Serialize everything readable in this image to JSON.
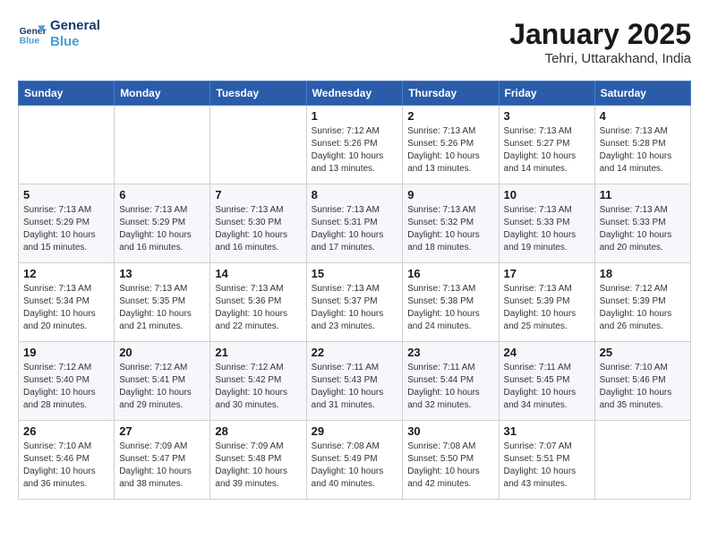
{
  "header": {
    "logo_line1": "General",
    "logo_line2": "Blue",
    "month_year": "January 2025",
    "location": "Tehri, Uttarakhand, India"
  },
  "weekdays": [
    "Sunday",
    "Monday",
    "Tuesday",
    "Wednesday",
    "Thursday",
    "Friday",
    "Saturday"
  ],
  "weeks": [
    [
      {
        "day": "",
        "sunrise": "",
        "sunset": "",
        "daylight": ""
      },
      {
        "day": "",
        "sunrise": "",
        "sunset": "",
        "daylight": ""
      },
      {
        "day": "",
        "sunrise": "",
        "sunset": "",
        "daylight": ""
      },
      {
        "day": "1",
        "sunrise": "Sunrise: 7:12 AM",
        "sunset": "Sunset: 5:26 PM",
        "daylight": "Daylight: 10 hours and 13 minutes."
      },
      {
        "day": "2",
        "sunrise": "Sunrise: 7:13 AM",
        "sunset": "Sunset: 5:26 PM",
        "daylight": "Daylight: 10 hours and 13 minutes."
      },
      {
        "day": "3",
        "sunrise": "Sunrise: 7:13 AM",
        "sunset": "Sunset: 5:27 PM",
        "daylight": "Daylight: 10 hours and 14 minutes."
      },
      {
        "day": "4",
        "sunrise": "Sunrise: 7:13 AM",
        "sunset": "Sunset: 5:28 PM",
        "daylight": "Daylight: 10 hours and 14 minutes."
      }
    ],
    [
      {
        "day": "5",
        "sunrise": "Sunrise: 7:13 AM",
        "sunset": "Sunset: 5:29 PM",
        "daylight": "Daylight: 10 hours and 15 minutes."
      },
      {
        "day": "6",
        "sunrise": "Sunrise: 7:13 AM",
        "sunset": "Sunset: 5:29 PM",
        "daylight": "Daylight: 10 hours and 16 minutes."
      },
      {
        "day": "7",
        "sunrise": "Sunrise: 7:13 AM",
        "sunset": "Sunset: 5:30 PM",
        "daylight": "Daylight: 10 hours and 16 minutes."
      },
      {
        "day": "8",
        "sunrise": "Sunrise: 7:13 AM",
        "sunset": "Sunset: 5:31 PM",
        "daylight": "Daylight: 10 hours and 17 minutes."
      },
      {
        "day": "9",
        "sunrise": "Sunrise: 7:13 AM",
        "sunset": "Sunset: 5:32 PM",
        "daylight": "Daylight: 10 hours and 18 minutes."
      },
      {
        "day": "10",
        "sunrise": "Sunrise: 7:13 AM",
        "sunset": "Sunset: 5:33 PM",
        "daylight": "Daylight: 10 hours and 19 minutes."
      },
      {
        "day": "11",
        "sunrise": "Sunrise: 7:13 AM",
        "sunset": "Sunset: 5:33 PM",
        "daylight": "Daylight: 10 hours and 20 minutes."
      }
    ],
    [
      {
        "day": "12",
        "sunrise": "Sunrise: 7:13 AM",
        "sunset": "Sunset: 5:34 PM",
        "daylight": "Daylight: 10 hours and 20 minutes."
      },
      {
        "day": "13",
        "sunrise": "Sunrise: 7:13 AM",
        "sunset": "Sunset: 5:35 PM",
        "daylight": "Daylight: 10 hours and 21 minutes."
      },
      {
        "day": "14",
        "sunrise": "Sunrise: 7:13 AM",
        "sunset": "Sunset: 5:36 PM",
        "daylight": "Daylight: 10 hours and 22 minutes."
      },
      {
        "day": "15",
        "sunrise": "Sunrise: 7:13 AM",
        "sunset": "Sunset: 5:37 PM",
        "daylight": "Daylight: 10 hours and 23 minutes."
      },
      {
        "day": "16",
        "sunrise": "Sunrise: 7:13 AM",
        "sunset": "Sunset: 5:38 PM",
        "daylight": "Daylight: 10 hours and 24 minutes."
      },
      {
        "day": "17",
        "sunrise": "Sunrise: 7:13 AM",
        "sunset": "Sunset: 5:39 PM",
        "daylight": "Daylight: 10 hours and 25 minutes."
      },
      {
        "day": "18",
        "sunrise": "Sunrise: 7:12 AM",
        "sunset": "Sunset: 5:39 PM",
        "daylight": "Daylight: 10 hours and 26 minutes."
      }
    ],
    [
      {
        "day": "19",
        "sunrise": "Sunrise: 7:12 AM",
        "sunset": "Sunset: 5:40 PM",
        "daylight": "Daylight: 10 hours and 28 minutes."
      },
      {
        "day": "20",
        "sunrise": "Sunrise: 7:12 AM",
        "sunset": "Sunset: 5:41 PM",
        "daylight": "Daylight: 10 hours and 29 minutes."
      },
      {
        "day": "21",
        "sunrise": "Sunrise: 7:12 AM",
        "sunset": "Sunset: 5:42 PM",
        "daylight": "Daylight: 10 hours and 30 minutes."
      },
      {
        "day": "22",
        "sunrise": "Sunrise: 7:11 AM",
        "sunset": "Sunset: 5:43 PM",
        "daylight": "Daylight: 10 hours and 31 minutes."
      },
      {
        "day": "23",
        "sunrise": "Sunrise: 7:11 AM",
        "sunset": "Sunset: 5:44 PM",
        "daylight": "Daylight: 10 hours and 32 minutes."
      },
      {
        "day": "24",
        "sunrise": "Sunrise: 7:11 AM",
        "sunset": "Sunset: 5:45 PM",
        "daylight": "Daylight: 10 hours and 34 minutes."
      },
      {
        "day": "25",
        "sunrise": "Sunrise: 7:10 AM",
        "sunset": "Sunset: 5:46 PM",
        "daylight": "Daylight: 10 hours and 35 minutes."
      }
    ],
    [
      {
        "day": "26",
        "sunrise": "Sunrise: 7:10 AM",
        "sunset": "Sunset: 5:46 PM",
        "daylight": "Daylight: 10 hours and 36 minutes."
      },
      {
        "day": "27",
        "sunrise": "Sunrise: 7:09 AM",
        "sunset": "Sunset: 5:47 PM",
        "daylight": "Daylight: 10 hours and 38 minutes."
      },
      {
        "day": "28",
        "sunrise": "Sunrise: 7:09 AM",
        "sunset": "Sunset: 5:48 PM",
        "daylight": "Daylight: 10 hours and 39 minutes."
      },
      {
        "day": "29",
        "sunrise": "Sunrise: 7:08 AM",
        "sunset": "Sunset: 5:49 PM",
        "daylight": "Daylight: 10 hours and 40 minutes."
      },
      {
        "day": "30",
        "sunrise": "Sunrise: 7:08 AM",
        "sunset": "Sunset: 5:50 PM",
        "daylight": "Daylight: 10 hours and 42 minutes."
      },
      {
        "day": "31",
        "sunrise": "Sunrise: 7:07 AM",
        "sunset": "Sunset: 5:51 PM",
        "daylight": "Daylight: 10 hours and 43 minutes."
      },
      {
        "day": "",
        "sunrise": "",
        "sunset": "",
        "daylight": ""
      }
    ]
  ]
}
